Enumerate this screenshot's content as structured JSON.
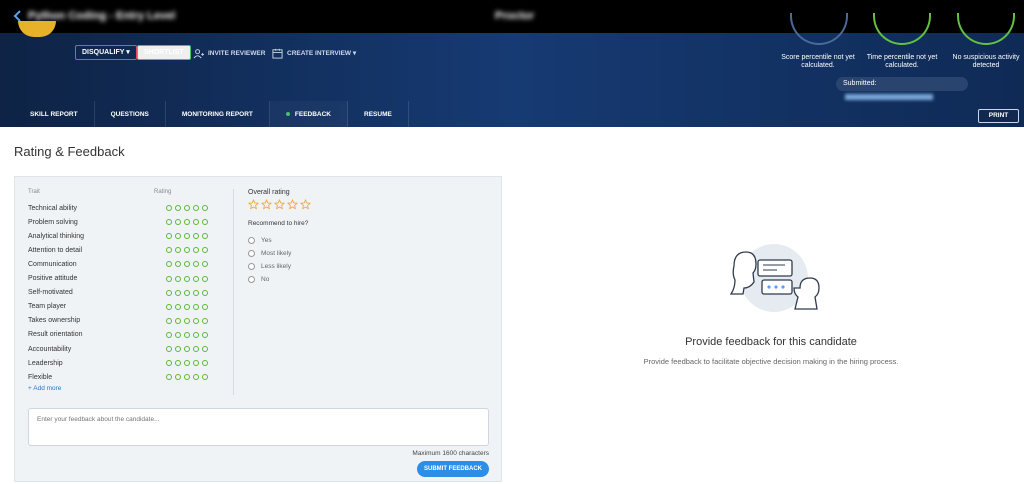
{
  "topbar": {
    "title": "Python Coding - Entry Level",
    "status": "Proctor"
  },
  "header": {
    "actions": {
      "disqualify": "DISQUALIFY ▾",
      "shortlist": "SHORTLIST",
      "invite_reviewer": "INVITE REVIEWER",
      "create_interview": "CREATE INTERVIEW ▾"
    },
    "metrics": [
      {
        "label": "Score percentile not yet calculated.",
        "color": "#4a6a98"
      },
      {
        "label": "Time percentile not yet calculated.",
        "color": "#63c13f"
      },
      {
        "label": "No suspicious activity detected",
        "color": "#63c13f"
      }
    ],
    "submitted_label": "Submitted:",
    "submitted_value": "Aug 00 2020, 11:30 pm"
  },
  "tabs": [
    {
      "label": "SKILL REPORT",
      "active": false
    },
    {
      "label": "QUESTIONS",
      "active": false
    },
    {
      "label": "MONITORING REPORT",
      "active": false
    },
    {
      "label": "FEEDBACK",
      "active": true
    },
    {
      "label": "RESUME",
      "active": false
    }
  ],
  "print_label": "PRINT",
  "page_title": "Rating & Feedback",
  "ratings": {
    "trait_header": "Trait",
    "rating_header": "Rating",
    "scale_max": 5,
    "traits": [
      "Technical ability",
      "Problem solving",
      "Analytical thinking",
      "Attention to detail",
      "Communication",
      "Positive attitude",
      "Self-motivated",
      "Team player",
      "Takes ownership",
      "Result orientation",
      "Accountability",
      "Leadership",
      "Flexible"
    ],
    "add_more": "+ Add more"
  },
  "overall": {
    "label": "Overall rating",
    "stars": 5
  },
  "recommend": {
    "label": "Recommend to hire?",
    "options": [
      "Yes",
      "Most likely",
      "Less likely",
      "No"
    ]
  },
  "feedback": {
    "placeholder": "Enter your feedback about the candidate...",
    "max_chars": "Maximum 1600 characters",
    "submit": "SUBMIT FEEDBACK"
  },
  "empty_state": {
    "title": "Provide feedback for this candidate",
    "description": "Provide feedback to facilitate objective decision making in the hiring process."
  },
  "colors": {
    "accent": "#2d8ee8",
    "rating_green": "#5ab934",
    "disqualify_red": "#e24a5a"
  }
}
